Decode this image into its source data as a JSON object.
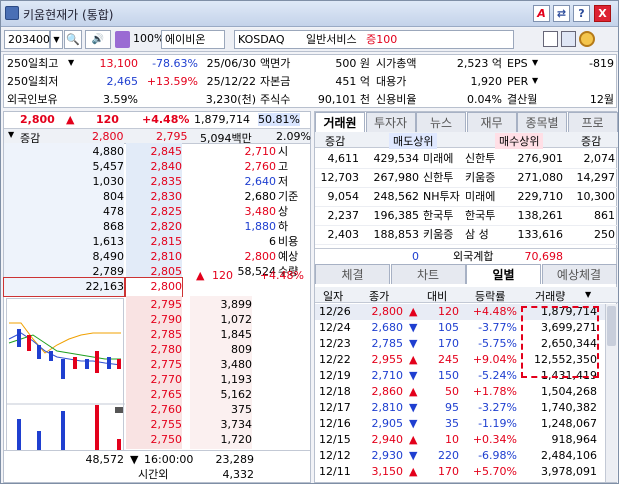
{
  "window": {
    "title": "키움현재가 (통합)",
    "btn_a": "A",
    "btn_link": "⇄",
    "btn_help": "?",
    "btn_close": "X"
  },
  "toolbar": {
    "code": "203400",
    "pct": "100%",
    "name": "에이비온",
    "market": "KOSDAQ",
    "sector": "일반서비스",
    "margin": "증100"
  },
  "info": {
    "r1": [
      "250일최고",
      "13,100",
      "-78.63%",
      "25/06/30",
      "액면가",
      "500 원",
      "시가총액",
      "2,523 억",
      "EPS",
      "-819"
    ],
    "r2": [
      "250일최저",
      "2,465",
      "+13.59%",
      "25/12/22",
      "자본금",
      "451 억",
      "대용가",
      "1,920",
      "PER",
      ""
    ],
    "r3": [
      "외국인보유",
      "3.59%",
      "3,230(천)",
      "주식수",
      "90,101 천",
      "신용비율",
      "0.04%",
      "결산월",
      "12월"
    ]
  },
  "price_bar": {
    "price": "2,800",
    "arrow": "▲",
    "change": "120",
    "rate": "+4.48%",
    "volume": "1,879,714",
    "ratio": "50.81%"
  },
  "orderbook": {
    "hdr": [
      "증감",
      "2,800",
      "2,795",
      "5,094백만",
      "2.09%"
    ],
    "asks": [
      {
        "qty": "4,880",
        "price": "2,845",
        "label": ""
      },
      {
        "qty": "5,457",
        "price": "2,840",
        "label": ""
      },
      {
        "qty": "1,030",
        "price": "2,835",
        "label": ""
      },
      {
        "qty": "804",
        "price": "2,830",
        "label": ""
      },
      {
        "qty": "478",
        "price": "2,825",
        "label": ""
      },
      {
        "qty": "868",
        "price": "2,820",
        "label": ""
      },
      {
        "qty": "1,613",
        "price": "2,815",
        "label": ""
      },
      {
        "qty": "8,490",
        "price": "2,810",
        "label": ""
      },
      {
        "qty": "2,789",
        "price": "2,805",
        "label": ""
      },
      {
        "qty": "22,163",
        "price": "2,800",
        "label": ""
      }
    ],
    "side_info": [
      {
        "v": "2,710",
        "k": "시",
        "c": "red"
      },
      {
        "v": "2,760",
        "k": "고",
        "c": "red"
      },
      {
        "v": "2,640",
        "k": "저",
        "c": "blue"
      },
      {
        "v": "2,680",
        "k": "기준",
        "c": ""
      },
      {
        "v": "3,480",
        "k": "상",
        "c": "red"
      },
      {
        "v": "1,880",
        "k": "하",
        "c": "blue"
      },
      {
        "v": "6",
        "k": "비용",
        "c": ""
      },
      {
        "v": "2,800",
        "k": "예상",
        "c": "red"
      },
      {
        "v": "58,524",
        "k": "수량",
        "c": ""
      }
    ],
    "exp_arrow": "▲",
    "exp_change": "120",
    "exp_rate": "+4.48%",
    "bids": [
      {
        "price": "2,795",
        "qty": "3,899"
      },
      {
        "price": "2,790",
        "qty": "1,072"
      },
      {
        "price": "2,785",
        "qty": "1,845"
      },
      {
        "price": "2,780",
        "qty": "809"
      },
      {
        "price": "2,775",
        "qty": "3,480"
      },
      {
        "price": "2,770",
        "qty": "1,193"
      },
      {
        "price": "2,765",
        "qty": "5,162"
      },
      {
        "price": "2,760",
        "qty": "375"
      },
      {
        "price": "2,755",
        "qty": "3,734"
      },
      {
        "price": "2,750",
        "qty": "1,720"
      }
    ],
    "total_ask": "48,572",
    "total_arrow": "▼",
    "total_bid_diff": "16:00:00",
    "total_bid": "23,289",
    "after_label": "시간외",
    "after_qty": "4,332"
  },
  "right_tabs": [
    "거래원",
    "투자자",
    "뉴스",
    "재무",
    "종목별",
    "프로"
  ],
  "broker": {
    "hdr": [
      "증감",
      "매도상위",
      "매수상위",
      "증감"
    ],
    "rows": [
      [
        "4,611",
        "429,534",
        "미래에",
        "신한투",
        "276,901",
        "2,074"
      ],
      [
        "12,703",
        "267,980",
        "신한투",
        "키움증",
        "271,080",
        "14,297"
      ],
      [
        "9,054",
        "248,562",
        "NH투자",
        "미래에",
        "229,710",
        "10,300"
      ],
      [
        "2,237",
        "196,385",
        "한국투",
        "한국투",
        "138,261",
        "861"
      ],
      [
        "2,403",
        "188,853",
        "키움증",
        "삼 성",
        "133,616",
        "250"
      ]
    ],
    "foreign": [
      "0",
      "외국계합",
      "70,698"
    ]
  },
  "sub_tabs": [
    "체결",
    "차트",
    "일별",
    "예상체결"
  ],
  "daily": {
    "hdr": [
      "일자",
      "종가",
      "대비",
      "등락률",
      "거래량"
    ],
    "rows": [
      {
        "d": "12/26",
        "p": "2,800",
        "a": "▲",
        "c": "120",
        "r": "+4.48%",
        "v": "1,879,714",
        "dir": "up"
      },
      {
        "d": "12/24",
        "p": "2,680",
        "a": "▼",
        "c": "105",
        "r": "-3.77%",
        "v": "3,699,271",
        "dir": "dn"
      },
      {
        "d": "12/23",
        "p": "2,785",
        "a": "▼",
        "c": "170",
        "r": "-5.75%",
        "v": "2,650,344",
        "dir": "dn"
      },
      {
        "d": "12/22",
        "p": "2,955",
        "a": "▲",
        "c": "245",
        "r": "+9.04%",
        "v": "12,552,350",
        "dir": "up"
      },
      {
        "d": "12/19",
        "p": "2,710",
        "a": "▼",
        "c": "150",
        "r": "-5.24%",
        "v": "1,431,419",
        "dir": "dn"
      },
      {
        "d": "12/18",
        "p": "2,860",
        "a": "▲",
        "c": "50",
        "r": "+1.78%",
        "v": "1,504,268",
        "dir": "up"
      },
      {
        "d": "12/17",
        "p": "2,810",
        "a": "▼",
        "c": "95",
        "r": "-3.27%",
        "v": "1,740,382",
        "dir": "dn"
      },
      {
        "d": "12/16",
        "p": "2,905",
        "a": "▼",
        "c": "35",
        "r": "-1.19%",
        "v": "1,248,067",
        "dir": "dn"
      },
      {
        "d": "12/15",
        "p": "2,940",
        "a": "▲",
        "c": "10",
        "r": "+0.34%",
        "v": "918,964",
        "dir": "up"
      },
      {
        "d": "12/12",
        "p": "2,930",
        "a": "▼",
        "c": "220",
        "r": "-6.98%",
        "v": "2,484,106",
        "dir": "dn"
      },
      {
        "d": "12/11",
        "p": "3,150",
        "a": "▲",
        "c": "170",
        "r": "+5.70%",
        "v": "3,978,091",
        "dir": "up"
      }
    ]
  },
  "colors": {
    "up": "#e3001b",
    "down": "#1f3fd0",
    "ask_bg": "#e9f0fb",
    "bid_bg": "#fbeaea"
  }
}
